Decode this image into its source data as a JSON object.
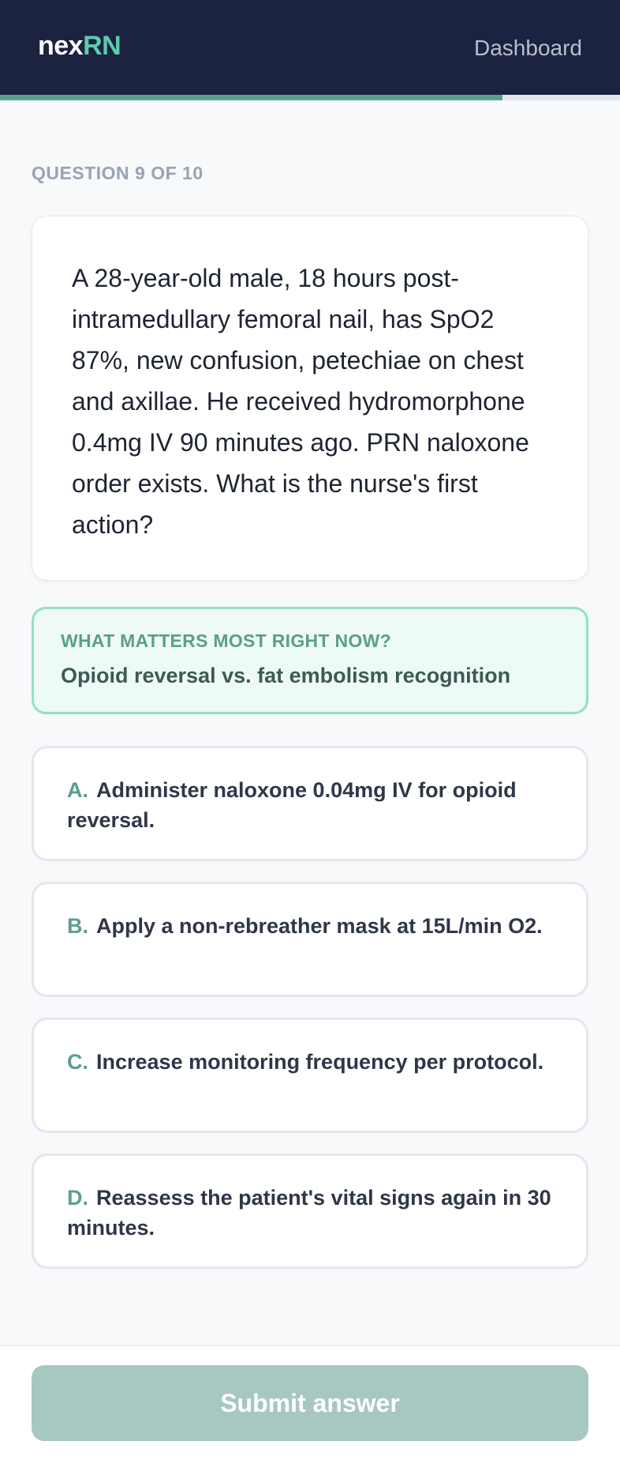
{
  "header": {
    "logo_part1": "nex",
    "logo_part2": "RN",
    "nav_link": "Dashboard",
    "brand_accent_color": "#5fc9ad",
    "background_color": "#1b2340"
  },
  "progress": {
    "current": 9,
    "total": 10,
    "fraction": 0.9
  },
  "question": {
    "label": "QUESTION 9 OF 10",
    "text": "A 28-year-old male, 18 hours post-intramedullary femoral nail, has SpO2 87%, new confusion, petechiae on chest and axillae. He received hydromorphone 0.4mg IV 90 minutes ago. PRN naloxone order exists. What is the nurse's first action?"
  },
  "hint": {
    "heading": "WHAT MATTERS MOST RIGHT NOW?",
    "body": "Opioid reversal vs. fat embolism recognition"
  },
  "options": [
    {
      "letter": "A.",
      "text": "Administer naloxone 0.04mg IV for opioid reversal."
    },
    {
      "letter": "B.",
      "text": "Apply a non-rebreather mask at 15L/min O2."
    },
    {
      "letter": "C.",
      "text": "Increase monitoring frequency per protocol."
    },
    {
      "letter": "D.",
      "text": "Reassess the patient's vital signs again in 30 minutes."
    }
  ],
  "submit": {
    "label": "Submit answer",
    "disabled": true
  }
}
